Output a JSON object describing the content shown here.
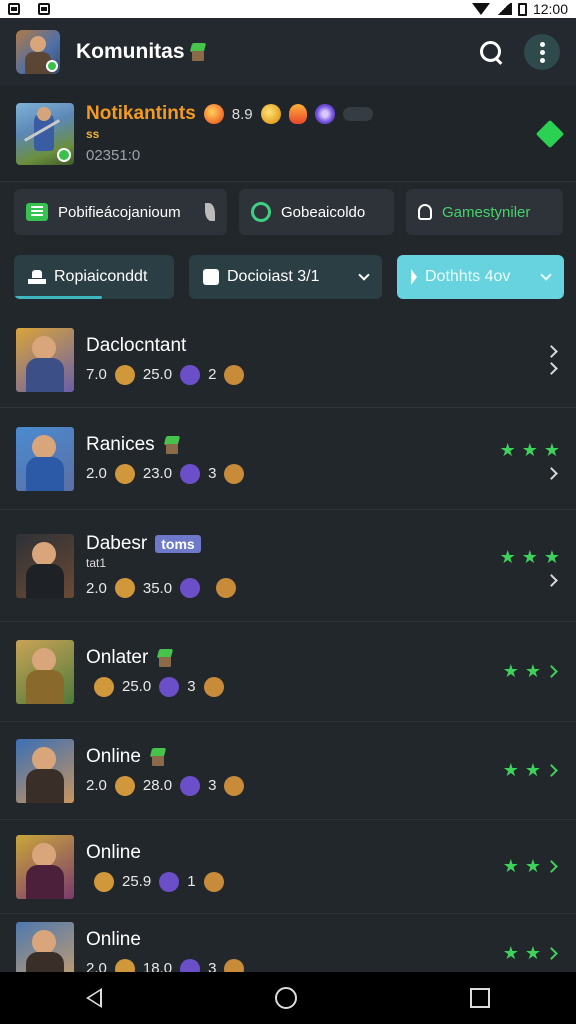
{
  "status_bar": {
    "time": "12:00"
  },
  "header": {
    "title": "Komunitas"
  },
  "profile": {
    "name": "Notikantints",
    "stat": "8.9",
    "sub": "ss",
    "id": "02351:0"
  },
  "chips": [
    {
      "label": "Pobifieácojanioum",
      "icon": "list-icon"
    },
    {
      "label": "Gobeaicoldo",
      "icon": "shield-icon"
    },
    {
      "label": "Gamestyniler",
      "icon": "person-icon"
    }
  ],
  "tabs": [
    {
      "label": "Ropiaiconddt",
      "icon": "hat-icon"
    },
    {
      "label": "Docioiast  3/1",
      "icon": "puzzle-icon"
    },
    {
      "label": "Dothhts  4ov",
      "icon": "cursor-icon"
    }
  ],
  "list": [
    {
      "name": "Daclocntant",
      "tag": "",
      "sub": "",
      "stat1": "7.0",
      "stat2": "25.0",
      "stat3": "2",
      "stars": 0,
      "thumb": [
        "#d9a43a",
        "#3c4f86",
        "#6a5fa8"
      ]
    },
    {
      "name": "Ranices",
      "tag": "",
      "sub": "",
      "stat1": "2.0",
      "stat2": "23.0",
      "stat3": "3",
      "stars": 3,
      "thumb": [
        "#4a8bd1",
        "#2d5aa6",
        "#5c6fa4"
      ]
    },
    {
      "name": "Dabesr",
      "tag": "toms",
      "sub": "tat1",
      "stat1": "2.0",
      "stat2": "35.0",
      "stat3": "",
      "stars": 3,
      "thumb": [
        "#2e3136",
        "#1e2226",
        "#6c4a34"
      ]
    },
    {
      "name": "Onlater",
      "tag": "",
      "sub": "",
      "stat1": "",
      "stat2": "25.0",
      "stat3": "3",
      "stars": 2,
      "thumb": [
        "#c9a357",
        "#8a6a2c",
        "#4d7a3a"
      ]
    },
    {
      "name": "Online",
      "tag": "",
      "sub": "",
      "stat1": "2.0",
      "stat2": "28.0",
      "stat3": "3",
      "stars": 2,
      "thumb": [
        "#3b6fb5",
        "#3a2e28",
        "#c8955f"
      ]
    },
    {
      "name": "Online",
      "tag": "",
      "sub": "",
      "stat1": "",
      "stat2": "25.9",
      "stat3": "1",
      "stars": 2,
      "thumb": [
        "#c9a63a",
        "#4c1f3a",
        "#7a3a6e"
      ]
    },
    {
      "name": "Online",
      "tag": "",
      "sub": "",
      "stat1": "2.0",
      "stat2": "18.0",
      "stat3": "3",
      "stars": 2,
      "thumb": [
        "#4e78b0",
        "#3a2e28",
        "#caa06a"
      ]
    }
  ]
}
